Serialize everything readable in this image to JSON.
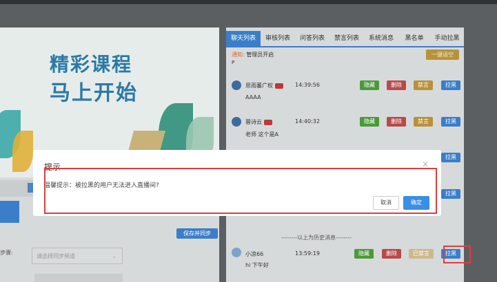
{
  "banner": {
    "line1": "精彩课程",
    "line2": "马上开始"
  },
  "left": {
    "sync_button": "保存并同步",
    "select_label": "步骤:",
    "select_placeholder": "请选择同步频道"
  },
  "tabs": [
    "聊天列表",
    "审核列表",
    "问答列表",
    "禁言列表",
    "系统消息",
    "黑名单",
    "手动拉黑"
  ],
  "notice": {
    "label": "通知:",
    "text": "管理员开启",
    "button": "一键语空",
    "extra": "P"
  },
  "actions": {
    "hide": "隐藏",
    "delete": "删除",
    "ban": "禁言",
    "blacklist": "拉黑",
    "banned": "已禁言"
  },
  "messages": [
    {
      "name": "思雨蕃广权",
      "time": "14:39:56",
      "text": "AAAA"
    },
    {
      "name": "蓉诗云",
      "time": "14:40:32",
      "text": "老师 这个是A"
    },
    {
      "name": "小凉66",
      "time": "13:59:19",
      "text": "hi 下午好"
    }
  ],
  "history_divider": "--------以上为历史消息--------",
  "dialog": {
    "title": "提示",
    "body": "温馨提示：被拉黑的用户无法进入直播间?",
    "cancel": "取消",
    "confirm": "确定"
  },
  "colors": {
    "primary": "#3a7ec9",
    "danger": "#b84a48",
    "success": "#4a9a3a",
    "warning": "#b8923a",
    "highlight": "#e33b3b"
  }
}
